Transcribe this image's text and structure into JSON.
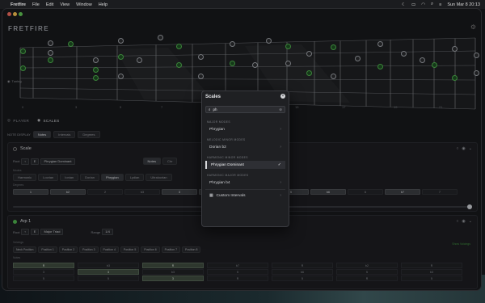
{
  "menubar": {
    "apple_icon": "apple-icon",
    "app_name": "Fretfire",
    "items": [
      "File",
      "Edit",
      "View",
      "Window",
      "Help"
    ],
    "datetime": "Sun Mar 8  20:13"
  },
  "app": {
    "logo": "FRETFIRE",
    "tuning_label": "Tuning",
    "fret_numbers": [
      "0",
      "3",
      "5",
      "7",
      "9",
      "12",
      "15",
      "17",
      "19",
      "21"
    ]
  },
  "tabs": [
    {
      "label": "PLAYER",
      "icon": "player-icon"
    },
    {
      "label": "SCALES",
      "icon": "scales-icon"
    }
  ],
  "mode_row": {
    "label": "NOTE DISPLAY",
    "options": [
      "Notes",
      "Intervals",
      "Degrees"
    ],
    "active": 0
  },
  "scale_panel": {
    "title": "Scale",
    "root_label": "Root",
    "root_value": "E",
    "scale_name": "Phrygian Dominant",
    "view_options": [
      "Notes",
      "Chr"
    ],
    "modes_label": "Modes",
    "modes": [
      "Harmonic",
      "Locrian",
      "Ionian",
      "Dorian",
      "Phrygian",
      "Lydian",
      "Ultralocrian"
    ],
    "active_mode": 4,
    "degrees_label": "Degrees",
    "degrees": [
      "1",
      "b2",
      "2",
      "b3",
      "3",
      "4",
      "b5",
      "5",
      "b6",
      "6",
      "b7",
      "7"
    ],
    "active_degrees": [
      0,
      1,
      4,
      5,
      7,
      8,
      10
    ],
    "slider_value": 1.0
  },
  "arp_panel": {
    "title": "Arp 1",
    "root_label": "Root",
    "root_value": "E",
    "chord_name": "Major Triad",
    "range_label": "Range",
    "range_value": "1/4",
    "voicings_label": "Voicings",
    "positions": [
      "Neck Position",
      "Position 1",
      "Position 2",
      "Position 3",
      "Position 4",
      "Position 5",
      "Position 6",
      "Position 7",
      "Position 8"
    ],
    "extra_link": "Show Voicings",
    "grid_label": "Notes",
    "columns": [
      [
        "R",
        "3",
        "5"
      ],
      [
        "b3",
        "3",
        "5"
      ],
      [
        "R",
        "b3",
        "3"
      ],
      [
        "b7",
        "5",
        "R"
      ],
      [
        "R",
        "b6",
        "5"
      ],
      [
        "b2",
        "5",
        "R"
      ],
      [
        "R",
        "b3",
        "5"
      ]
    ],
    "lit": [
      [
        0,
        0
      ],
      [
        1,
        1
      ],
      [
        2,
        0
      ],
      [
        2,
        2
      ]
    ]
  },
  "scales_modal": {
    "title": "Scales",
    "search_value": "ph",
    "groups": [
      {
        "label": "MAJOR MODES",
        "items": [
          "Phrygian"
        ]
      },
      {
        "label": "MELODIC MINOR MODES",
        "items": [
          "Dorian b2"
        ]
      },
      {
        "label": "HARMONIC MINOR MODES",
        "items": [
          "Phrygian Dominant"
        ]
      },
      {
        "label": "HARMONIC MAJOR MODES",
        "items": [
          "Phrygian b4"
        ]
      }
    ],
    "selected": "Phrygian Dominant",
    "custom_label": "Custom Intervals"
  }
}
